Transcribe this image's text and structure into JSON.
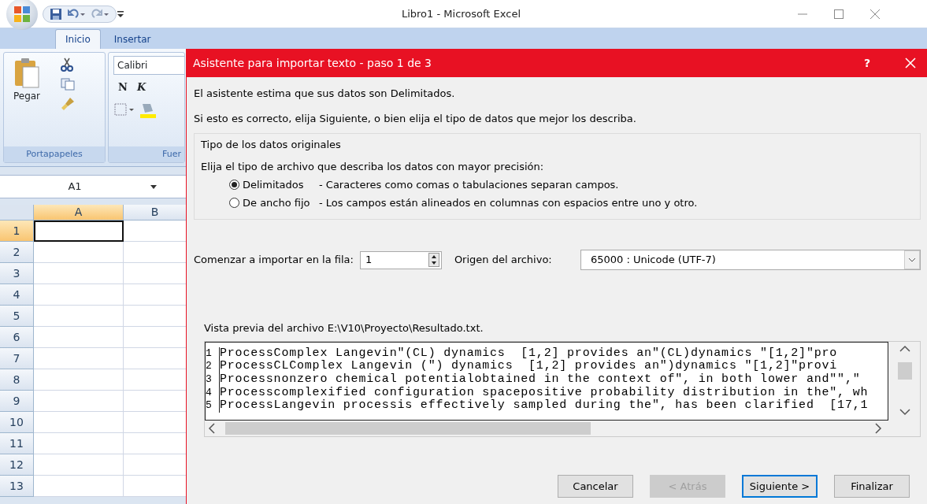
{
  "excel": {
    "title": "Libro1 - Microsoft Excel",
    "tabs": [
      {
        "label": "Inicio",
        "selected": true
      },
      {
        "label": "Insertar",
        "selected": false
      }
    ],
    "ribbon": {
      "paste_label": "Pegar",
      "font_name": "Calibri",
      "bold_key": "N",
      "italic_key": "K",
      "clipboard_group": "Portapapeles",
      "font_group": "Fuer"
    },
    "name_box": "A1",
    "columns": [
      {
        "label": "A",
        "selected": true
      },
      {
        "label": "B",
        "selected": false
      }
    ],
    "rows": [
      {
        "label": "1",
        "selected": true
      },
      {
        "label": "2",
        "selected": false
      },
      {
        "label": "3",
        "selected": false
      },
      {
        "label": "4",
        "selected": false
      },
      {
        "label": "5",
        "selected": false
      },
      {
        "label": "6",
        "selected": false
      },
      {
        "label": "7",
        "selected": false
      },
      {
        "label": "8",
        "selected": false
      },
      {
        "label": "9",
        "selected": false
      },
      {
        "label": "10",
        "selected": false
      },
      {
        "label": "11",
        "selected": false
      },
      {
        "label": "12",
        "selected": false
      },
      {
        "label": "13",
        "selected": false
      }
    ]
  },
  "dialog": {
    "title": "Asistente para importar texto - paso 1 de 3",
    "help": "?",
    "intro": [
      "El asistente estima que sus datos son Delimitados.",
      "Si esto es correcto, elija Siguiente, o bien elija el tipo de datos que mejor los describa."
    ],
    "group": {
      "legend": "Tipo de los datos originales",
      "prompt": "Elija el tipo de archivo que describa los datos con mayor precisión:",
      "options": [
        {
          "label": "Delimitados",
          "description": "- Caracteres como comas o tabulaciones separan campos.",
          "selected": true
        },
        {
          "label": "De ancho fijo",
          "description": "- Los campos están alineados en columnas con espacios entre uno y otro.",
          "selected": false
        }
      ]
    },
    "start_row": {
      "label": "Comenzar a importar en la fila:",
      "value": "1"
    },
    "origin": {
      "label": "Origen del archivo:",
      "value": "65000 : Unicode (UTF-7)"
    },
    "preview": {
      "label": "Vista previa del archivo E:\\V10\\Proyecto\\Resultado.txt.",
      "lines": [
        {
          "number": "1",
          "text": "ProcessComplex Langevin\"(CL) dynamics  [1,2] provides an\"(CL)dynamics \"[1,2]\"pro"
        },
        {
          "number": "2",
          "text": "ProcessCLComplex Langevin (\") dynamics  [1,2] provides an\")dynamics \"[1,2]\"provi"
        },
        {
          "number": "3",
          "text": "Processnonzero chemical potentialobtained in the context of\", in both lower and\"\",\""
        },
        {
          "number": "4",
          "text": "Processcomplexified configuration spacepositive probability distribution in the\", wh"
        },
        {
          "number": "5",
          "text": "ProcessLangevin processis effectively sampled during the\", has been clarified  [17,1"
        }
      ]
    },
    "buttons": [
      {
        "label": "Cancelar",
        "disabled": false,
        "default": false
      },
      {
        "label": "< Atrás",
        "disabled": true,
        "default": false
      },
      {
        "label": "Siguiente >",
        "disabled": false,
        "default": true
      },
      {
        "label": "Finalizar",
        "disabled": false,
        "default": false
      }
    ]
  }
}
